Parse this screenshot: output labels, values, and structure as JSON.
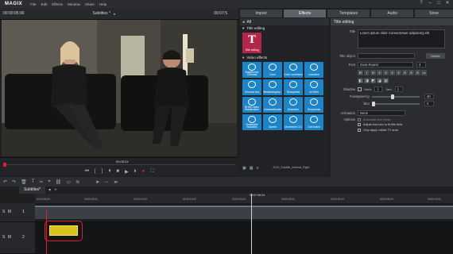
{
  "app": {
    "logo": "MAGIX",
    "project_title": "Subtitles *"
  },
  "menu": [
    "File",
    "Edit",
    "Effects",
    "Window",
    "Share",
    "Help"
  ],
  "preview": {
    "timecode_left": "00:00:05:00",
    "timecode_right": "00:07:5",
    "scrub_timecode": "00:05:24"
  },
  "tabs": [
    "Import",
    "Effects",
    "Templates",
    "Audio",
    "Store"
  ],
  "effects": {
    "all_label": "All",
    "title_section": "Title editing",
    "title_tile": "Title editing",
    "video_section": "Video effects",
    "tiles": [
      "Brightness/ Contrast",
      "Color",
      "Color correction",
      "Ivanview",
      "Chroma key",
      "Weakeningrey...",
      "Sharpness",
      "Art filter",
      "RHMI Video Stabilization",
      "Unsweetheate",
      "Distortion",
      "Sharpness",
      "Smart/elle blackfills",
      "Speed",
      "Movement 3.0",
      "Dot match"
    ]
  },
  "title_panel": {
    "header": "Title editing",
    "title_label": "Title",
    "title_text": "Lorem ipsum dolor Consectetuer adipiscing elit",
    "title_object_label": "Title object",
    "delete_label": "Delete",
    "font_label": "Font",
    "font_value": "Gara Round",
    "font_size": "4",
    "shadow_label": "Shadow",
    "horiz_label": "Horiz.",
    "horiz_value": "1",
    "vert_label": "Vert.",
    "vert_value": "1",
    "transparency_label": "Transparency",
    "transparency_value": "40",
    "blur_label": "Blur",
    "blur_value": "0",
    "animation_label": "Animation",
    "animation_value": "None",
    "options_label": "Options",
    "opt1": "Automatic line break",
    "opt2": "Adjust font size to fit title field",
    "opt3": "Only apply visible TV area"
  },
  "export_file": "2015_Subtitle_Interval_Right",
  "project_tab": "Subtitles*",
  "ruler": {
    "center_label": "00:07:35:24",
    "ticks": [
      "00:00:00:00",
      "00:00:05:00",
      "00:00:10:00",
      "00:00:15:00",
      "00:00:20:00",
      "00:00:25:00",
      "00:00:30:00",
      "00:00:35:00",
      "00:00:40:00"
    ]
  },
  "tracks": [
    {
      "id": "1",
      "sm": "S M"
    },
    {
      "id": "2",
      "sm": "S M"
    }
  ],
  "colors": {
    "accent_blue": "#1d84c7",
    "title_red": "#b3264a",
    "clip_yellow": "#d9c21a",
    "highlight": "#e01f2a"
  }
}
